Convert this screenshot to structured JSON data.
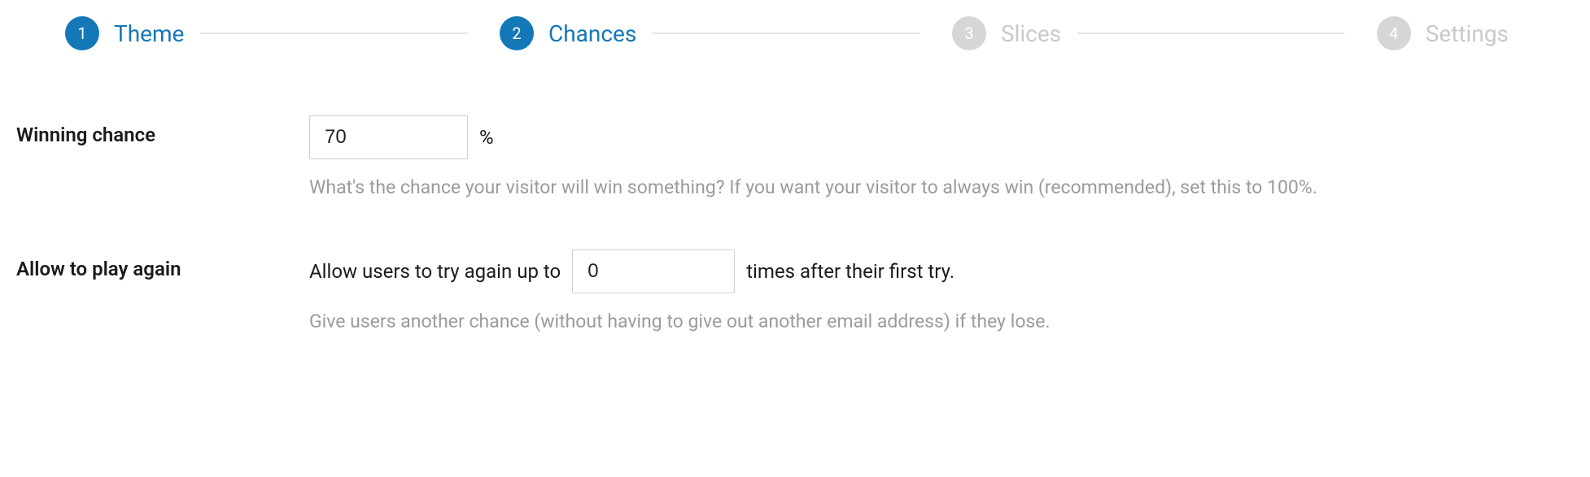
{
  "stepper": {
    "steps": [
      {
        "num": "1",
        "label": "Theme"
      },
      {
        "num": "2",
        "label": "Chances"
      },
      {
        "num": "3",
        "label": "Slices"
      },
      {
        "num": "4",
        "label": "Settings"
      }
    ]
  },
  "form": {
    "winning_chance": {
      "label": "Winning chance",
      "value": "70",
      "suffix": "%",
      "desc": "What's the chance your visitor will win something? If you want your visitor to always win (recommended), set this to 100%."
    },
    "play_again": {
      "label": "Allow to play again",
      "prefix": "Allow users to try again up to",
      "value": "0",
      "suffix": "times after their first try.",
      "desc": "Give users another chance (without having to give out another email address) if they lose."
    }
  }
}
